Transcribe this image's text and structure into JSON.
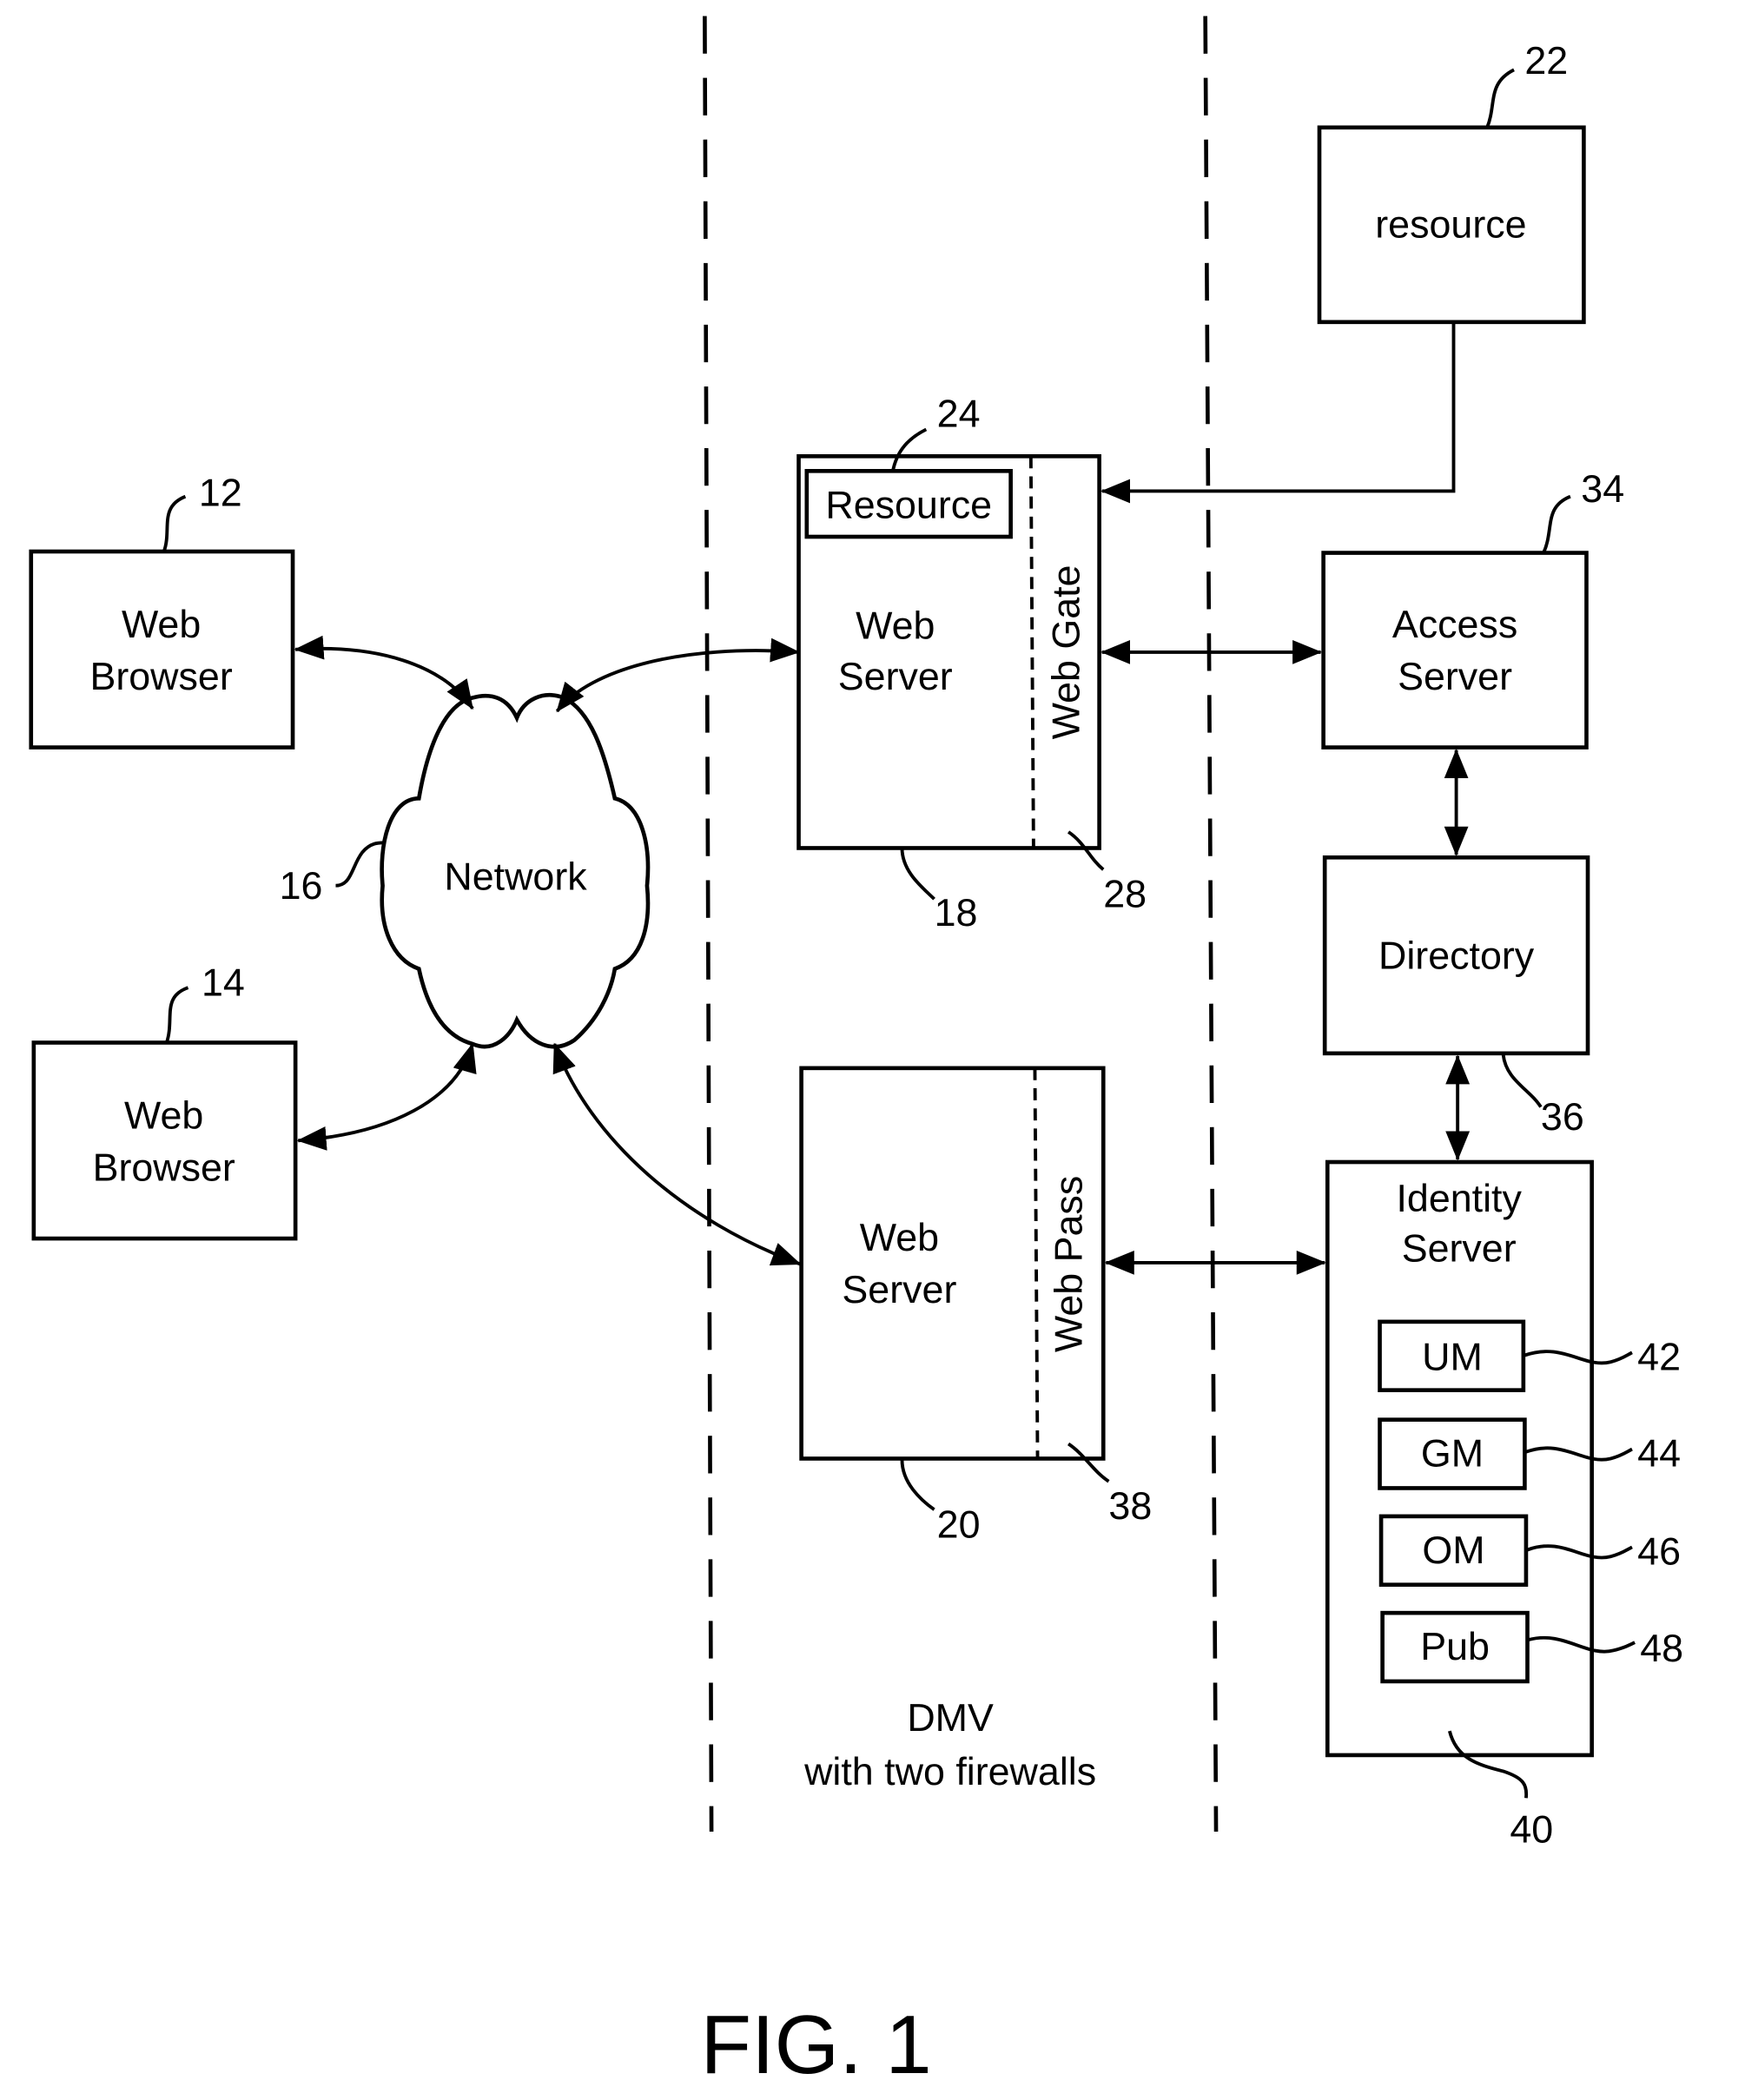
{
  "figure": {
    "caption": "FIG. 1",
    "zone_label_line1": "DMV",
    "zone_label_line2": "with  two firewalls"
  },
  "nodes": {
    "browser1": {
      "line1": "Web",
      "line2": "Browser",
      "ref": "12"
    },
    "browser2": {
      "line1": "Web",
      "line2": "Browser",
      "ref": "14"
    },
    "network": {
      "label": "Network",
      "ref": "16"
    },
    "webserver1": {
      "line1": "Web",
      "line2": "Server",
      "ref": "18",
      "inner_resource": "Resource",
      "inner_resource_ref": "24",
      "gate_label": "Web Gate",
      "gate_ref": "28"
    },
    "webserver2": {
      "line1": "Web",
      "line2": "Server",
      "ref": "20",
      "pass_label": "Web Pass",
      "pass_ref": "38"
    },
    "resource": {
      "label": "resource",
      "ref": "22"
    },
    "access_server": {
      "line1": "Access",
      "line2": "Server",
      "ref": "34"
    },
    "directory": {
      "label": "Directory",
      "ref": "36"
    },
    "identity_server": {
      "line1": "Identity",
      "line2": "Server",
      "ref": "40",
      "modules": [
        {
          "label": "UM",
          "ref": "42"
        },
        {
          "label": "GM",
          "ref": "44"
        },
        {
          "label": "OM",
          "ref": "46"
        },
        {
          "label": "Pub",
          "ref": "48"
        }
      ]
    }
  }
}
